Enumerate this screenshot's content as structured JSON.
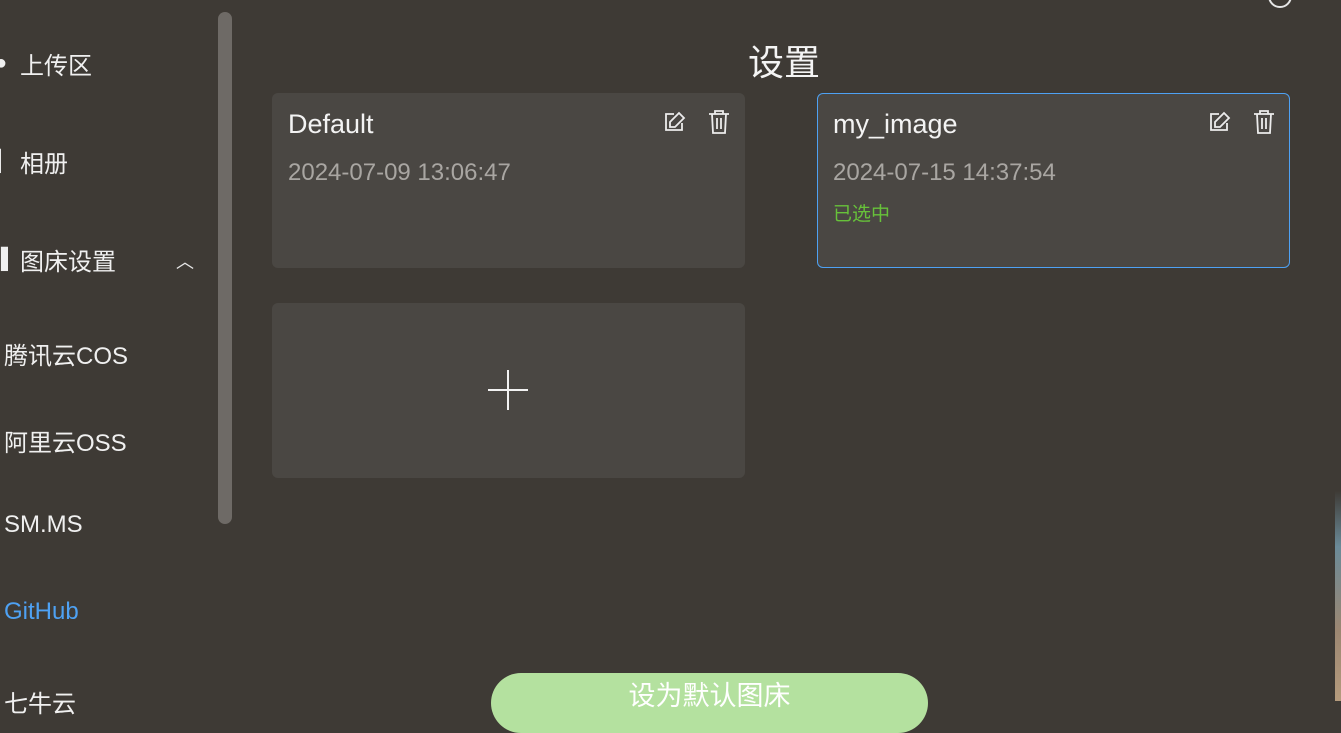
{
  "sidebar": {
    "items": [
      {
        "label": "上传区",
        "icon": "dot-icon"
      },
      {
        "label": "相册",
        "icon": "album-icon"
      },
      {
        "label": "图床设置",
        "icon": "settings-icon"
      }
    ],
    "sub_items": [
      {
        "label": "腾讯云COS"
      },
      {
        "label": "阿里云OSS"
      },
      {
        "label": "SM.MS"
      },
      {
        "label": "GitHub",
        "active": true
      },
      {
        "label": "七牛云"
      }
    ],
    "expand_icon": "chevron-up-icon"
  },
  "main": {
    "title": "设置",
    "configs": [
      {
        "name": "Default",
        "time": "2024-07-09 13:06:47",
        "selected": false,
        "status": ""
      },
      {
        "name": "my_image",
        "time": "2024-07-15 14:37:54",
        "selected": true,
        "status": "已选中"
      }
    ],
    "add_icon": "plus-icon",
    "default_button_label": "设为默认图床"
  },
  "colors": {
    "background": "#3e3a35",
    "card": "#4a4743",
    "accent": "#4ea1f3",
    "success": "#67c23a",
    "button": "#b4e19f"
  }
}
